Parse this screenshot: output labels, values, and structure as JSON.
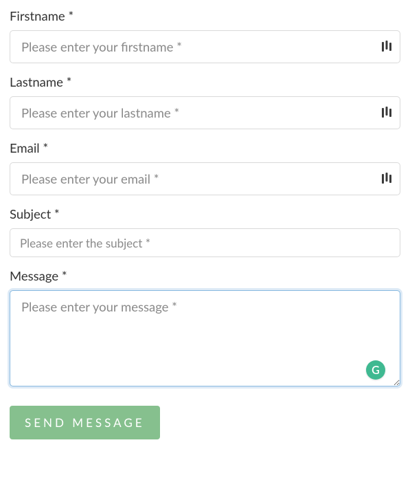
{
  "fields": {
    "firstname": {
      "label": "Firstname *",
      "placeholder": "Please enter your firstname *"
    },
    "lastname": {
      "label": "Lastname *",
      "placeholder": "Please enter your lastname *"
    },
    "email": {
      "label": "Email *",
      "placeholder": "Please enter your email *"
    },
    "subject": {
      "label": "Subject *",
      "placeholder": "Please enter the subject *"
    },
    "message": {
      "label": "Message *",
      "placeholder": "Please enter your message *"
    }
  },
  "badge": {
    "letter": "G"
  },
  "button": {
    "send": "SEND MESSAGE"
  }
}
